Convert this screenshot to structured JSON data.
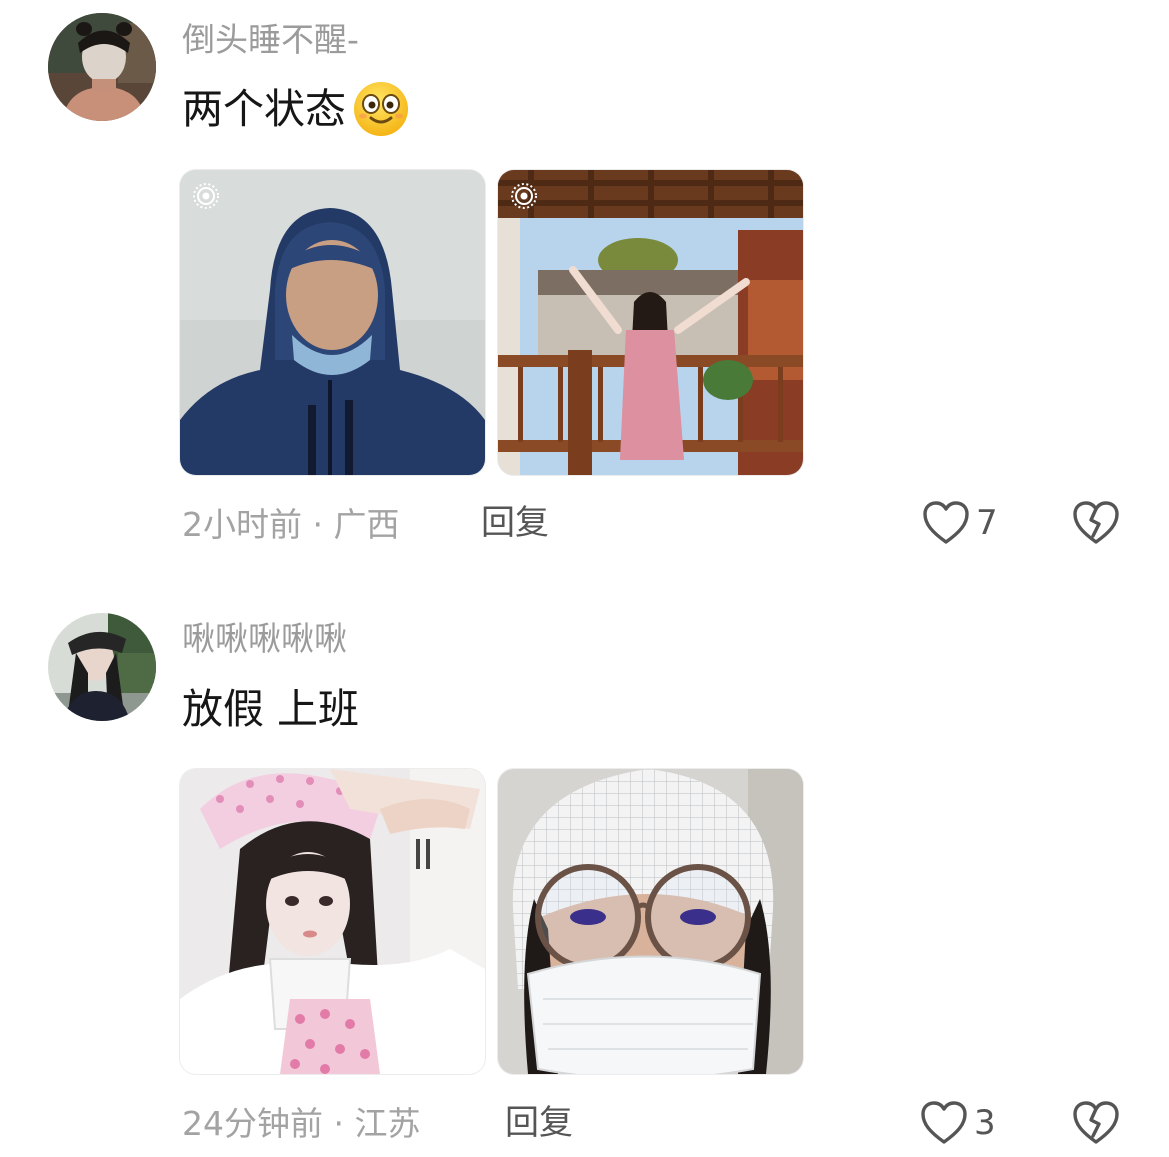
{
  "comments": [
    {
      "username": "倒头睡不醒-",
      "text": "两个状态",
      "emoji_icon": "smiling-face-emoji",
      "images": [
        {
          "name": "selfie-blue-hood",
          "live_icon": "live-photo-icon"
        },
        {
          "name": "girl-courtyard-wooden-balcony",
          "live_icon": "live-photo-icon"
        }
      ],
      "time": "2小时前",
      "location": "广西",
      "meta": "2小时前 · 广西",
      "reply_label": "回复",
      "like_icon": "heart-icon",
      "like_count": "7",
      "dislike_icon": "broken-heart-icon"
    },
    {
      "username": "啾啾啾啾啾",
      "text": "放假 上班",
      "images": [
        {
          "name": "girl-pink-maid-cosplay"
        },
        {
          "name": "selfie-hairnet-glasses-mask"
        }
      ],
      "time": "24分钟前",
      "location": "江苏",
      "meta": "24分钟前 · 江苏",
      "reply_label": "回复",
      "like_icon": "heart-icon",
      "like_count": "3",
      "dislike_icon": "broken-heart-icon"
    }
  ],
  "colors": {
    "username": "#9b9b9b",
    "text": "#161616",
    "meta": "#a3a3a3",
    "action": "#555555"
  }
}
